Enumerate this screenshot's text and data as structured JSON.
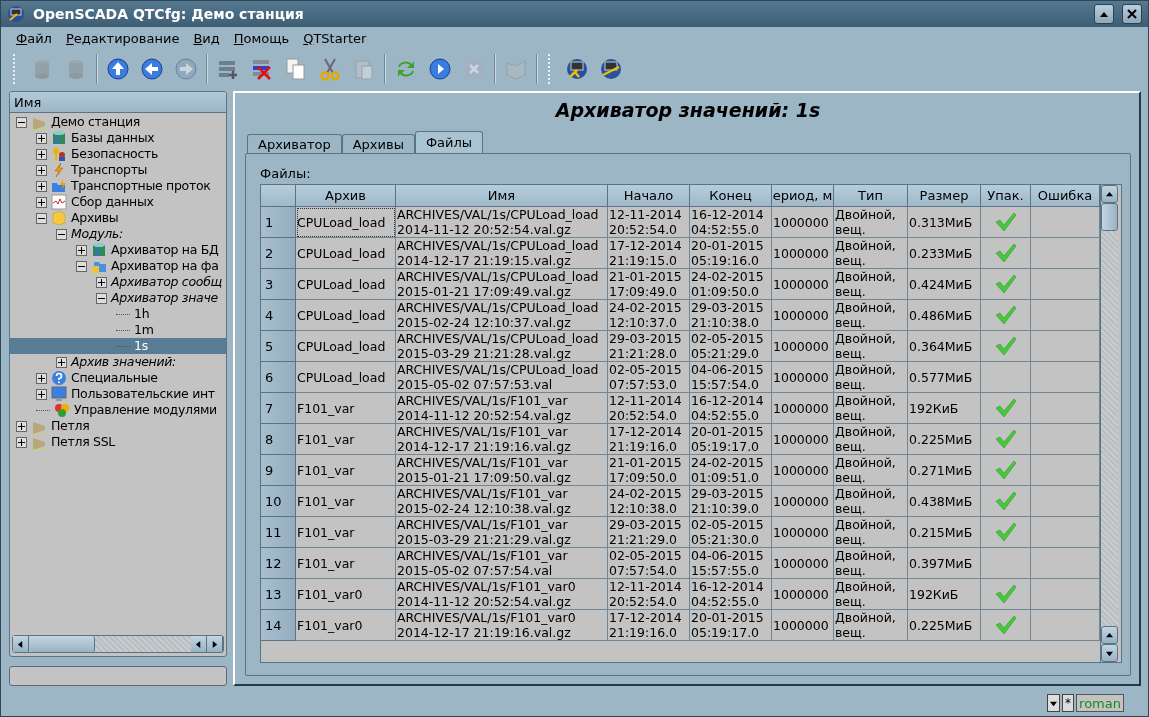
{
  "window": {
    "title": "OpenSCADA QTCfg: Демо станция"
  },
  "menu": [
    "Файл",
    "Редактирование",
    "Вид",
    "Помощь",
    "QTStarter"
  ],
  "toolbar": [
    {
      "kind": "db-load",
      "disabled": true
    },
    {
      "kind": "db-save",
      "disabled": true
    },
    {
      "kind": "sep"
    },
    {
      "kind": "up",
      "disabled": false
    },
    {
      "kind": "back",
      "disabled": false
    },
    {
      "kind": "forward",
      "disabled": true
    },
    {
      "kind": "sep"
    },
    {
      "kind": "add",
      "disabled": false
    },
    {
      "kind": "delete",
      "disabled": false
    },
    {
      "kind": "copy",
      "disabled": false
    },
    {
      "kind": "cut",
      "disabled": false
    },
    {
      "kind": "paste",
      "disabled": true
    },
    {
      "kind": "sep"
    },
    {
      "kind": "refresh",
      "disabled": false
    },
    {
      "kind": "start",
      "disabled": false
    },
    {
      "kind": "stop",
      "disabled": true
    },
    {
      "kind": "sep"
    },
    {
      "kind": "book",
      "disabled": true
    },
    {
      "kind": "sep"
    },
    {
      "kind": "tool",
      "disabled": false
    },
    {
      "kind": "tool2",
      "disabled": false
    }
  ],
  "tree": {
    "header": "Имя",
    "items": [
      {
        "label": "Демо станция",
        "expanded": true,
        "selected": false,
        "italic": false,
        "children": [
          {
            "label": "Базы данных",
            "expanded": false,
            "selected": false,
            "italic": false
          },
          {
            "label": "Безопасность",
            "expanded": false,
            "selected": false,
            "italic": false
          },
          {
            "label": "Транспорты",
            "expanded": false,
            "selected": false,
            "italic": false
          },
          {
            "label": "Транспортные проток",
            "expanded": false,
            "selected": false,
            "italic": false
          },
          {
            "label": "Сбор данных",
            "expanded": false,
            "selected": false,
            "italic": false
          },
          {
            "label": "Архивы",
            "expanded": true,
            "selected": false,
            "italic": false,
            "children": [
              {
                "label": "Модуль:",
                "expanded": true,
                "selected": false,
                "italic": true,
                "children": [
                  {
                    "label": "Архиватор на БД",
                    "expanded": false,
                    "selected": false,
                    "italic": false
                  },
                  {
                    "label": "Архиватор на фа",
                    "expanded": true,
                    "selected": false,
                    "italic": false,
                    "children": [
                      {
                        "label": "Архиватор сообщ",
                        "expanded": false,
                        "selected": false,
                        "italic": true
                      },
                      {
                        "label": "Архиватор значе",
                        "expanded": true,
                        "selected": false,
                        "italic": true,
                        "children": [
                          {
                            "label": "1h",
                            "selected": false,
                            "italic": false
                          },
                          {
                            "label": "1m",
                            "selected": false,
                            "italic": false
                          },
                          {
                            "label": "1s",
                            "selected": true,
                            "italic": false
                          }
                        ]
                      }
                    ]
                  }
                ]
              },
              {
                "label": "Архив значений:",
                "expanded": false,
                "selected": false,
                "italic": true
              }
            ]
          },
          {
            "label": "Специальные",
            "expanded": false,
            "selected": false,
            "italic": false
          },
          {
            "label": "Пользовательские инт",
            "expanded": false,
            "selected": false,
            "italic": false
          },
          {
            "label": "Управление модулями",
            "selected": false,
            "italic": false
          }
        ]
      },
      {
        "label": "Петля",
        "expanded": false,
        "selected": false,
        "italic": false
      },
      {
        "label": "Петля SSL",
        "expanded": false,
        "selected": false,
        "italic": false
      }
    ]
  },
  "page": {
    "title": "Архиватор значений: 1s",
    "tabs": [
      {
        "label": "Архиватор",
        "selected": false
      },
      {
        "label": "Архивы",
        "selected": false
      },
      {
        "label": "Файлы",
        "selected": true
      }
    ],
    "group_label": "Файлы:",
    "table": {
      "columns": [
        "Архив",
        "Имя",
        "Начало",
        "Конец",
        "ериод, м",
        "Тип",
        "Размер",
        "Упак.",
        "Ошибка"
      ],
      "rows": [
        {
          "number": "1",
          "archive": "CPULoad_load",
          "name": "ARCHIVES/VAL/1s/CPULoad_load 2014-11-12 20:52:54.val.gz",
          "begin": "12-11-2014 20:52:54.0",
          "end": "16-12-2014 04:52:55.0",
          "period": "1000000",
          "type": "Двойной, вещ.",
          "size": "0.313МиБ",
          "packed": true,
          "focused": true
        },
        {
          "number": "2",
          "archive": "CPULoad_load",
          "name": "ARCHIVES/VAL/1s/CPULoad_load 2014-12-17 21:19:15.val.gz",
          "begin": "17-12-2014 21:19:15.0",
          "end": "20-01-2015 05:19:16.0",
          "period": "1000000",
          "type": "Двойной, вещ.",
          "size": "0.233МиБ",
          "packed": true,
          "focused": false
        },
        {
          "number": "3",
          "archive": "CPULoad_load",
          "name": "ARCHIVES/VAL/1s/CPULoad_load 2015-01-21 17:09:49.val.gz",
          "begin": "21-01-2015 17:09:49.0",
          "end": "24-02-2015 01:09:50.0",
          "period": "1000000",
          "type": "Двойной, вещ.",
          "size": "0.424МиБ",
          "packed": true,
          "focused": false
        },
        {
          "number": "4",
          "archive": "CPULoad_load",
          "name": "ARCHIVES/VAL/1s/CPULoad_load 2015-02-24 12:10:37.val.gz",
          "begin": "24-02-2015 12:10:37.0",
          "end": "29-03-2015 21:10:38.0",
          "period": "1000000",
          "type": "Двойной, вещ.",
          "size": "0.486МиБ",
          "packed": true,
          "focused": false
        },
        {
          "number": "5",
          "archive": "CPULoad_load",
          "name": "ARCHIVES/VAL/1s/CPULoad_load 2015-03-29 21:21:28.val.gz",
          "begin": "29-03-2015 21:21:28.0",
          "end": "02-05-2015 05:21:29.0",
          "period": "1000000",
          "type": "Двойной, вещ.",
          "size": "0.364МиБ",
          "packed": true,
          "focused": false
        },
        {
          "number": "6",
          "archive": "CPULoad_load",
          "name": "ARCHIVES/VAL/1s/CPULoad_load 2015-05-02 07:57:53.val",
          "begin": "02-05-2015 07:57:53.0",
          "end": "04-06-2015 15:57:54.0",
          "period": "1000000",
          "type": "Двойной, вещ.",
          "size": "0.577МиБ",
          "packed": false,
          "focused": false
        },
        {
          "number": "7",
          "archive": "F101_var",
          "name": "ARCHIVES/VAL/1s/F101_var 2014-11-12 20:52:54.val.gz",
          "begin": "12-11-2014 20:52:54.0",
          "end": "16-12-2014 04:52:55.0",
          "period": "1000000",
          "type": "Двойной, вещ.",
          "size": "192КиБ",
          "packed": true,
          "focused": false
        },
        {
          "number": "8",
          "archive": "F101_var",
          "name": "ARCHIVES/VAL/1s/F101_var 2014-12-17 21:19:16.val.gz",
          "begin": "17-12-2014 21:19:16.0",
          "end": "20-01-2015 05:19:17.0",
          "period": "1000000",
          "type": "Двойной, вещ.",
          "size": "0.225МиБ",
          "packed": true,
          "focused": false
        },
        {
          "number": "9",
          "archive": "F101_var",
          "name": "ARCHIVES/VAL/1s/F101_var 2015-01-21 17:09:50.val.gz",
          "begin": "21-01-2015 17:09:50.0",
          "end": "24-02-2015 01:09:51.0",
          "period": "1000000",
          "type": "Двойной, вещ.",
          "size": "0.271МиБ",
          "packed": true,
          "focused": false
        },
        {
          "number": "10",
          "archive": "F101_var",
          "name": "ARCHIVES/VAL/1s/F101_var 2015-02-24 12:10:38.val.gz",
          "begin": "24-02-2015 12:10:38.0",
          "end": "29-03-2015 21:10:39.0",
          "period": "1000000",
          "type": "Двойной, вещ.",
          "size": "0.438МиБ",
          "packed": true,
          "focused": false
        },
        {
          "number": "11",
          "archive": "F101_var",
          "name": "ARCHIVES/VAL/1s/F101_var 2015-03-29 21:21:29.val.gz",
          "begin": "29-03-2015 21:21:29.0",
          "end": "02-05-2015 05:21:30.0",
          "period": "1000000",
          "type": "Двойной, вещ.",
          "size": "0.215МиБ",
          "packed": true,
          "focused": false
        },
        {
          "number": "12",
          "archive": "F101_var",
          "name": "ARCHIVES/VAL/1s/F101_var 2015-05-02 07:57:54.val",
          "begin": "02-05-2015 07:57:54.0",
          "end": "04-06-2015 15:57:55.0",
          "period": "1000000",
          "type": "Двойной, вещ.",
          "size": "0.397МиБ",
          "packed": false,
          "focused": false
        },
        {
          "number": "13",
          "archive": "F101_var0",
          "name": "ARCHIVES/VAL/1s/F101_var0 2014-11-12 20:52:54.val.gz",
          "begin": "12-11-2014 20:52:54.0",
          "end": "16-12-2014 04:52:55.0",
          "period": "1000000",
          "type": "Двойной, вещ.",
          "size": "192КиБ",
          "packed": true,
          "focused": false
        },
        {
          "number": "14",
          "archive": "F101_var0",
          "name": "ARCHIVES/VAL/1s/F101_var0 2014-12-17 21:19:16.val.gz",
          "begin": "17-12-2014 21:19:16.0",
          "end": "20-01-2015 05:19:17.0",
          "period": "1000000",
          "type": "Двойной, вещ.",
          "size": "0.225МиБ",
          "packed": true,
          "focused": false
        }
      ]
    }
  },
  "status_bar": {
    "modified_mark": "*",
    "user": "roman"
  }
}
